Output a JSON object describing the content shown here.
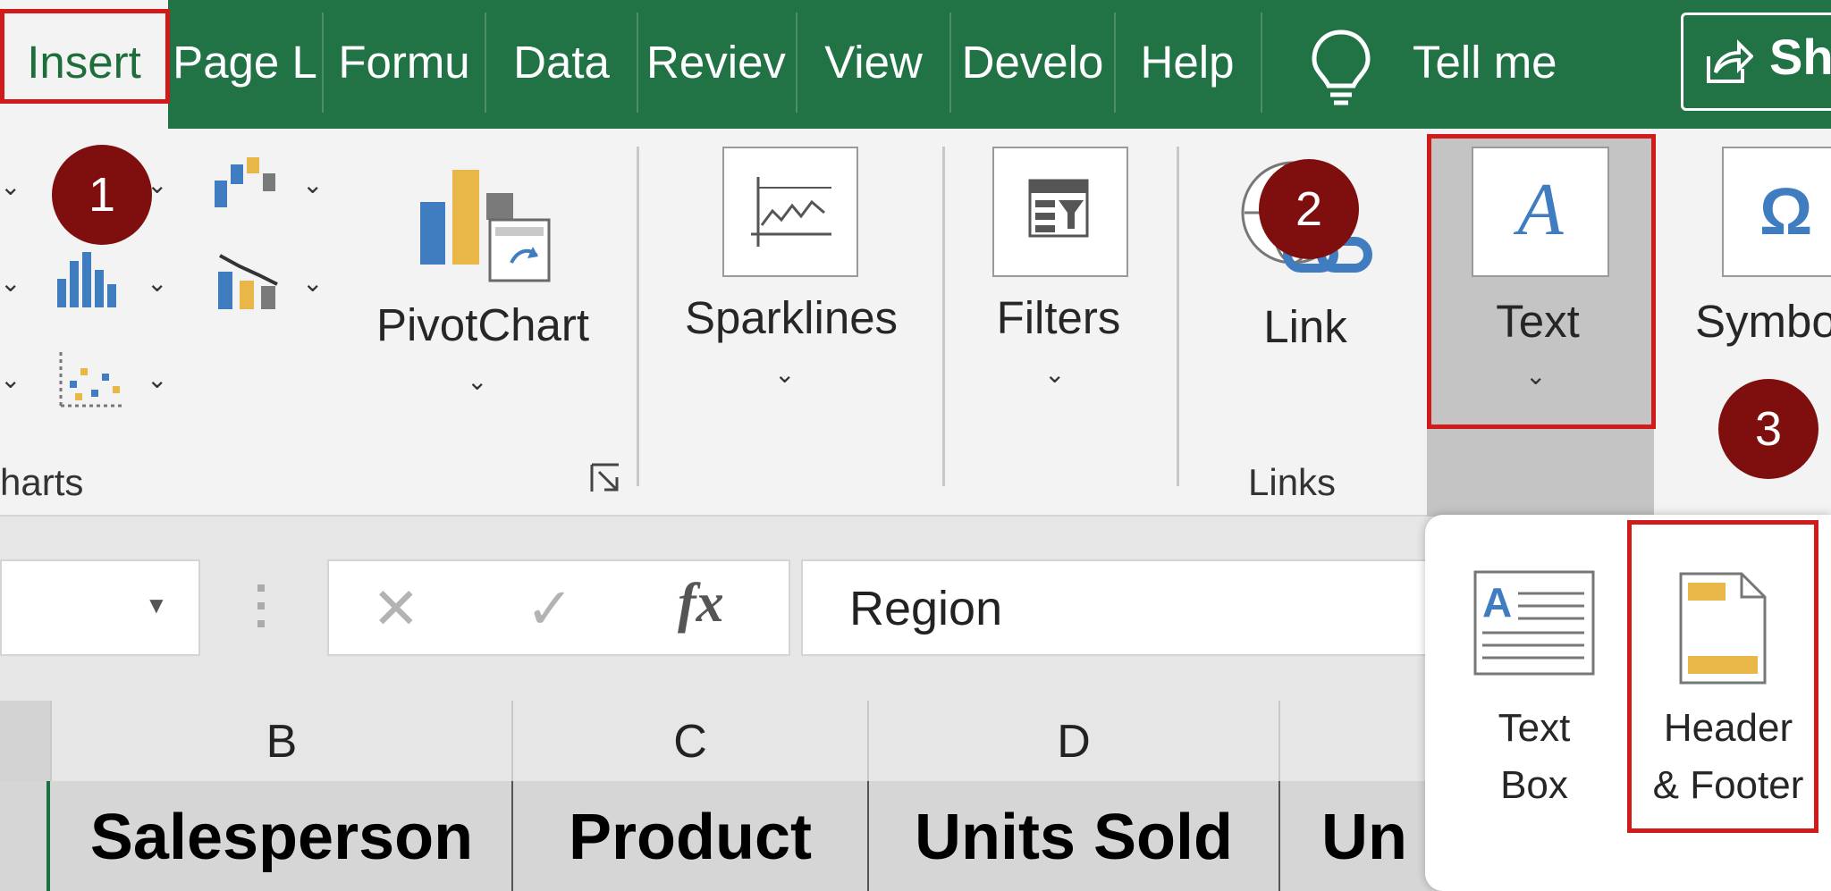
{
  "tabs": [
    {
      "label": "Insert",
      "active": true
    },
    {
      "label": "Page L",
      "active": false
    },
    {
      "label": "Formu",
      "active": false
    },
    {
      "label": "Data",
      "active": false
    },
    {
      "label": "Reviev",
      "active": false
    },
    {
      "label": "View",
      "active": false
    },
    {
      "label": "Develo",
      "active": false
    },
    {
      "label": "Help",
      "active": false
    }
  ],
  "tell_me": "Tell me",
  "share_label": "Sh",
  "ribbon": {
    "charts_group_label": "harts",
    "pivotchart_label": "PivotChart",
    "sparklines_label": "Sparklines",
    "filters_label": "Filters",
    "link_label": "Link",
    "links_group_label": "Links",
    "text_label": "Text",
    "symbols_label": "Symbo"
  },
  "formula_bar": {
    "cancel_glyph": "✕",
    "enter_glyph": "✓",
    "fx_label": "fx",
    "value": "Region"
  },
  "grid": {
    "columns": [
      "B",
      "C",
      "D"
    ],
    "headers": [
      "Salesperson",
      "Product",
      "Units Sold",
      "Un"
    ]
  },
  "text_dropdown": {
    "text_box_label_1": "Text",
    "text_box_label_2": "Box",
    "header_footer_label_1": "Header",
    "header_footer_label_2": "& Footer"
  },
  "badges": [
    "1",
    "2",
    "3"
  ],
  "colors": {
    "ribbon_green": "#217346",
    "badge": "#7f0f0f",
    "highlight": "#d11b1b",
    "icon_blue": "#3f7cc0",
    "icon_gold": "#e9b748"
  }
}
